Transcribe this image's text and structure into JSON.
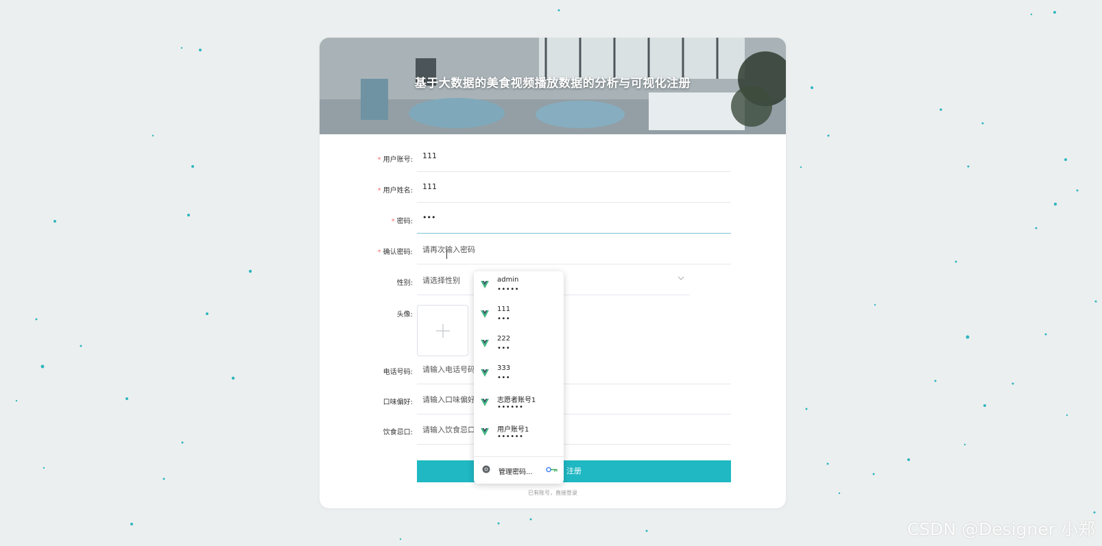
{
  "page": {
    "title": "基于大数据的美食视频播放数据的分析与可视化注册",
    "watermark": "CSDN @Designer 小郑"
  },
  "form": {
    "account": {
      "label": "用户账号:",
      "value": "111",
      "required": true
    },
    "name": {
      "label": "用户姓名:",
      "value": "111",
      "required": true
    },
    "password": {
      "label": "密码:",
      "value": "•••",
      "required": true
    },
    "confirm_password": {
      "label": "确认密码:",
      "placeholder": "请再次输入密码",
      "required": true
    },
    "gender": {
      "label": "性别:",
      "placeholder": "请选择性别"
    },
    "avatar": {
      "label": "头像:"
    },
    "phone": {
      "label": "电话号码:",
      "placeholder": "请输入电话号码"
    },
    "taste": {
      "label": "口味偏好:",
      "placeholder": "请输入口味偏好"
    },
    "diet": {
      "label": "饮食忌口:",
      "placeholder": "请输入饮食忌口"
    },
    "submit_label": "注册",
    "login_link": "已有账号，直接登录"
  },
  "autofill": {
    "items": [
      {
        "username": "admin",
        "password_mask": "•••••"
      },
      {
        "username": "111",
        "password_mask": "•••"
      },
      {
        "username": "222",
        "password_mask": "•••"
      },
      {
        "username": "333",
        "password_mask": "•••"
      },
      {
        "username": "志愿者账号1",
        "password_mask": "••••••"
      },
      {
        "username": "用户账号1",
        "password_mask": "••••••"
      }
    ],
    "manage_label": "管理密码...",
    "icon": "vue-logo-icon"
  },
  "colors": {
    "accent": "#1fb8c3",
    "required": "#f56c6c",
    "vue_green": "#42b883",
    "vue_dark": "#35495e"
  }
}
